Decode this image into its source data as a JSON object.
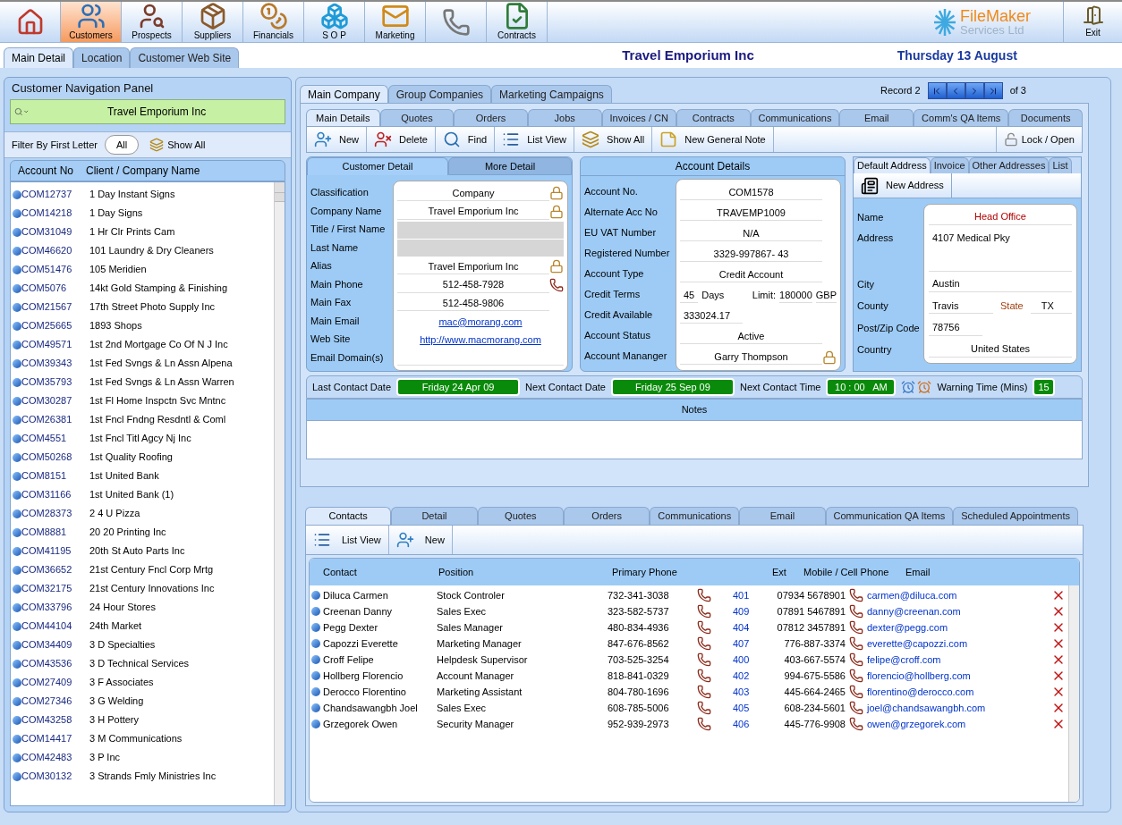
{
  "modules": [
    {
      "kind": "home",
      "selected": false
    },
    {
      "kind": "customers",
      "label": "Customers",
      "selected": true
    },
    {
      "kind": "prospects",
      "label": "Prospects",
      "selected": false
    },
    {
      "kind": "suppliers",
      "label": "Suppliers",
      "selected": false
    },
    {
      "kind": "financials",
      "label": "Financials",
      "selected": false
    },
    {
      "kind": "sop",
      "label": "S O P",
      "selected": false
    },
    {
      "kind": "marketing",
      "label": "Marketing",
      "selected": false
    },
    {
      "kind": "phone",
      "selected": false
    },
    {
      "kind": "contracts",
      "label": "Contracts",
      "selected": false
    }
  ],
  "logo": {
    "line1": "FileMaker",
    "line2": "Services Ltd"
  },
  "exit_button": "Exit",
  "page_tabs": [
    {
      "label": "Main Detail",
      "selected": true
    },
    {
      "label": "Location",
      "selected": false
    },
    {
      "label": "Customer Web Site",
      "selected": false
    }
  ],
  "company_title": "Travel Emporium Inc",
  "date": "Thursday 13 August",
  "nav_panel": {
    "title": "Customer Navigation Panel",
    "search_value": "Travel Emporium Inc",
    "filter_label": "Filter By First Letter",
    "all_button": "All",
    "show_all_button": "Show All",
    "columns": [
      "Account No",
      "Client / Company Name"
    ],
    "rows": [
      {
        "account": "COM12737",
        "name": "1 Day Instant Signs"
      },
      {
        "account": "COM14218",
        "name": "1 Day Signs"
      },
      {
        "account": "COM31049",
        "name": "1 Hr Clr Prints Cam"
      },
      {
        "account": "COM46620",
        "name": "101 Laundry & Dry Cleaners"
      },
      {
        "account": "COM51476",
        "name": "105 Meridien"
      },
      {
        "account": "COM5076",
        "name": "14kt Gold Stamping & Finishing"
      },
      {
        "account": "COM21567",
        "name": "17th Street Photo Supply Inc"
      },
      {
        "account": "COM25665",
        "name": "1893 Shops"
      },
      {
        "account": "COM49571",
        "name": "1st 2nd Mortgage Co Of N J Inc"
      },
      {
        "account": "COM39343",
        "name": "1st Fed Svngs & Ln Assn Alpena"
      },
      {
        "account": "COM35793",
        "name": "1st Fed Svngs & Ln Assn Warren"
      },
      {
        "account": "COM30287",
        "name": "1st Fl Home Inspctn Svc Mntnc"
      },
      {
        "account": "COM26381",
        "name": "1st Fncl Fndng Resdntl & Coml"
      },
      {
        "account": "COM4551",
        "name": "1st Fncl Titl Agcy Nj Inc"
      },
      {
        "account": "COM50268",
        "name": "1st Quality Roofing"
      },
      {
        "account": "COM8151",
        "name": "1st United Bank"
      },
      {
        "account": "COM31166",
        "name": "1st United Bank (1)"
      },
      {
        "account": "COM28373",
        "name": "2 4 U Pizza"
      },
      {
        "account": "COM8881",
        "name": "20 20 Printing Inc"
      },
      {
        "account": "COM41195",
        "name": "20th St Auto Parts Inc"
      },
      {
        "account": "COM36652",
        "name": "21st Century Fncl Corp Mrtg"
      },
      {
        "account": "COM32175",
        "name": "21st Century Innovations Inc"
      },
      {
        "account": "COM33796",
        "name": "24 Hour Stores"
      },
      {
        "account": "COM44104",
        "name": "24th Market"
      },
      {
        "account": "COM34409",
        "name": "3 D Specialties"
      },
      {
        "account": "COM43536",
        "name": "3 D Technical Services"
      },
      {
        "account": "COM27409",
        "name": "3 F Associates"
      },
      {
        "account": "COM27346",
        "name": "3 G Welding"
      },
      {
        "account": "COM43258",
        "name": "3 H Pottery"
      },
      {
        "account": "COM14417",
        "name": "3 M Communications"
      },
      {
        "account": "COM42483",
        "name": "3 P Inc"
      },
      {
        "account": "COM30132",
        "name": "3 Strands Fmly Ministries Inc"
      }
    ]
  },
  "company_tabs": [
    {
      "label": "Main Company",
      "selected": true
    },
    {
      "label": "Group Companies",
      "selected": false
    },
    {
      "label": "Marketing Campaigns",
      "selected": false
    }
  ],
  "record": {
    "label": "Record 2",
    "of": "of 3"
  },
  "detail_tabs": [
    {
      "label": "Main Details",
      "selected": true
    },
    {
      "label": "Quotes",
      "selected": false
    },
    {
      "label": "Orders",
      "selected": false
    },
    {
      "label": "Jobs",
      "selected": false
    },
    {
      "label": "Invoices / CN",
      "selected": false
    },
    {
      "label": "Contracts",
      "selected": false
    },
    {
      "label": "Communications",
      "selected": false
    },
    {
      "label": "Email",
      "selected": false
    },
    {
      "label": "Comm's QA Items",
      "selected": false
    },
    {
      "label": "Documents",
      "selected": false
    }
  ],
  "toolbar": [
    {
      "kind": "new",
      "label": "New"
    },
    {
      "kind": "delete",
      "label": "Delete"
    },
    {
      "kind": "find",
      "label": "Find"
    },
    {
      "kind": "list",
      "label": "List View"
    },
    {
      "kind": "showall",
      "label": "Show All"
    },
    {
      "kind": "note",
      "label": "New General Note"
    }
  ],
  "lock_button": "Lock / Open",
  "customer_detail": {
    "tabs": [
      {
        "label": "Customer Detail",
        "selected": true
      },
      {
        "label": "More Detail",
        "selected": false
      }
    ],
    "fields": [
      {
        "label": "Classification",
        "kind": "locked",
        "value": "Company"
      },
      {
        "label": "Company Name",
        "kind": "locked",
        "value": "Travel Emporium Inc"
      },
      {
        "label": "Title / First Name",
        "kind": "greyed"
      },
      {
        "label": "Last Name",
        "kind": "greyed"
      },
      {
        "label": "Alias",
        "kind": "locked",
        "value": "Travel Emporium Inc"
      },
      {
        "label": "Main Phone",
        "kind": "phone",
        "value": "512-458-7928"
      },
      {
        "label": "Main Fax",
        "kind": "text",
        "value": "512-458-9806"
      },
      {
        "label": "Main Email",
        "kind": "link",
        "value": "mac@morang.com"
      },
      {
        "label": "Web Site",
        "kind": "link",
        "value": "http://www.macmorang.com"
      },
      {
        "label": "Email Domain(s)",
        "kind": "empty"
      }
    ]
  },
  "account_details": {
    "title": "Account Details",
    "fields": [
      {
        "label": "Account  No.",
        "kind": "text",
        "value": "COM1578"
      },
      {
        "label": "Alternate Acc No",
        "kind": "text",
        "value": "TRAVEMP1009"
      },
      {
        "label": "EU VAT Number",
        "kind": "text",
        "value": "N/A"
      },
      {
        "label": "Registered Number",
        "kind": "text",
        "value": "3329-997867- 43"
      },
      {
        "label": "Account Type",
        "kind": "text",
        "value": "Credit Account"
      },
      {
        "label": "Credit Terms",
        "kind": "terms",
        "value": "45",
        "unit": "Days",
        "limit_label": "Limit:",
        "limit": "180000",
        "currency": "GBP"
      },
      {
        "label": "Credit Available",
        "kind": "short",
        "value": "333024.17"
      },
      {
        "label": "Account Status",
        "kind": "text",
        "value": "Active"
      },
      {
        "label": "Account Mananger",
        "kind": "locked",
        "value": "Garry Thompson"
      }
    ]
  },
  "address": {
    "tabs": [
      {
        "label": "Default Address",
        "selected": true
      },
      {
        "label": "Invoice",
        "selected": false
      },
      {
        "label": "Other Addresses",
        "selected": false
      },
      {
        "label": "List",
        "selected": false
      }
    ],
    "new_address_button": "New Address",
    "fields": [
      {
        "label": "Name",
        "kind": "highlight",
        "value": "Head Office"
      },
      {
        "label": "Address",
        "kind": "multiline",
        "value": "4107 Medical Pky"
      },
      {
        "label": "City",
        "kind": "left",
        "value": "Austin"
      },
      {
        "label": "County",
        "kind": "county",
        "value": "Travis",
        "state_label": "State",
        "state": "TX"
      },
      {
        "label": "Post/Zip Code",
        "kind": "short",
        "value": "78756"
      },
      {
        "label": "Country",
        "kind": "center",
        "value": "United States"
      }
    ]
  },
  "contact_bar": {
    "items": [
      {
        "label": "Last Contact Date",
        "value": "Friday 24 Apr 09"
      },
      {
        "label": "Next Contact Date",
        "value": "Friday 25 Sep 09"
      },
      {
        "label": "Next Contact Time",
        "value": "10 : 00   AM"
      }
    ],
    "warning_label": "Warning Time (Mins)",
    "warning_value": "15"
  },
  "notes": {
    "title": "Notes"
  },
  "contact_tabs": [
    {
      "label": "Contacts",
      "selected": true
    },
    {
      "label": "Detail",
      "selected": false
    },
    {
      "label": "Quotes",
      "selected": false
    },
    {
      "label": "Orders",
      "selected": false
    },
    {
      "label": "Communications",
      "selected": false
    },
    {
      "label": "Email",
      "selected": false
    },
    {
      "label": "Communication QA Items",
      "selected": false
    },
    {
      "label": "Scheduled Appointments",
      "selected": false
    }
  ],
  "contact_toolbar": [
    {
      "kind": "list",
      "label": "List View"
    },
    {
      "kind": "new",
      "label": "New"
    }
  ],
  "contacts": {
    "columns": [
      "Contact",
      "Position",
      "Primary Phone",
      "Ext",
      "Mobile / Cell Phone",
      "Email"
    ],
    "rows": [
      {
        "contact": "Diluca Carmen",
        "position": "Stock Controler",
        "phone": "732-341-3038",
        "ext": "401",
        "mobile": "07934 5678901",
        "email": "carmen@diluca.com"
      },
      {
        "contact": "Creenan Danny",
        "position": "Sales Exec",
        "phone": "323-582-5737",
        "ext": "409",
        "mobile": "07891 5467891",
        "email": "danny@creenan.com"
      },
      {
        "contact": "Pegg Dexter",
        "position": "Sales Manager",
        "phone": "480-834-4936",
        "ext": "404",
        "mobile": "07812 3457891",
        "email": "dexter@pegg.com"
      },
      {
        "contact": "Capozzi Everette",
        "position": "Marketing Manager",
        "phone": "847-676-8562",
        "ext": "407",
        "mobile": "776-887-3374",
        "email": "everette@capozzi.com"
      },
      {
        "contact": "Croff Felipe",
        "position": "Helpdesk Supervisor",
        "phone": "703-525-3254",
        "ext": "400",
        "mobile": "403-667-5574",
        "email": "felipe@croff.com"
      },
      {
        "contact": "Hollberg Florencio",
        "position": "Account Manager",
        "phone": "818-841-0329",
        "ext": "402",
        "mobile": "994-675-5586",
        "email": "florencio@hollberg.com"
      },
      {
        "contact": "Derocco Florentino",
        "position": "Marketing Assistant",
        "phone": "804-780-1696",
        "ext": "403",
        "mobile": "445-664-2465",
        "email": "florentino@derocco.com"
      },
      {
        "contact": "Chandsawangbh Joel",
        "position": "Sales Exec",
        "phone": "608-785-5006",
        "ext": "405",
        "mobile": "608-234-5601",
        "email": "joel@chandsawangbh.com"
      },
      {
        "contact": "Grzegorek Owen",
        "position": "Security Manager",
        "phone": "952-939-2973",
        "ext": "406",
        "mobile": "445-776-9908",
        "email": "owen@grzegorek.com"
      }
    ]
  }
}
